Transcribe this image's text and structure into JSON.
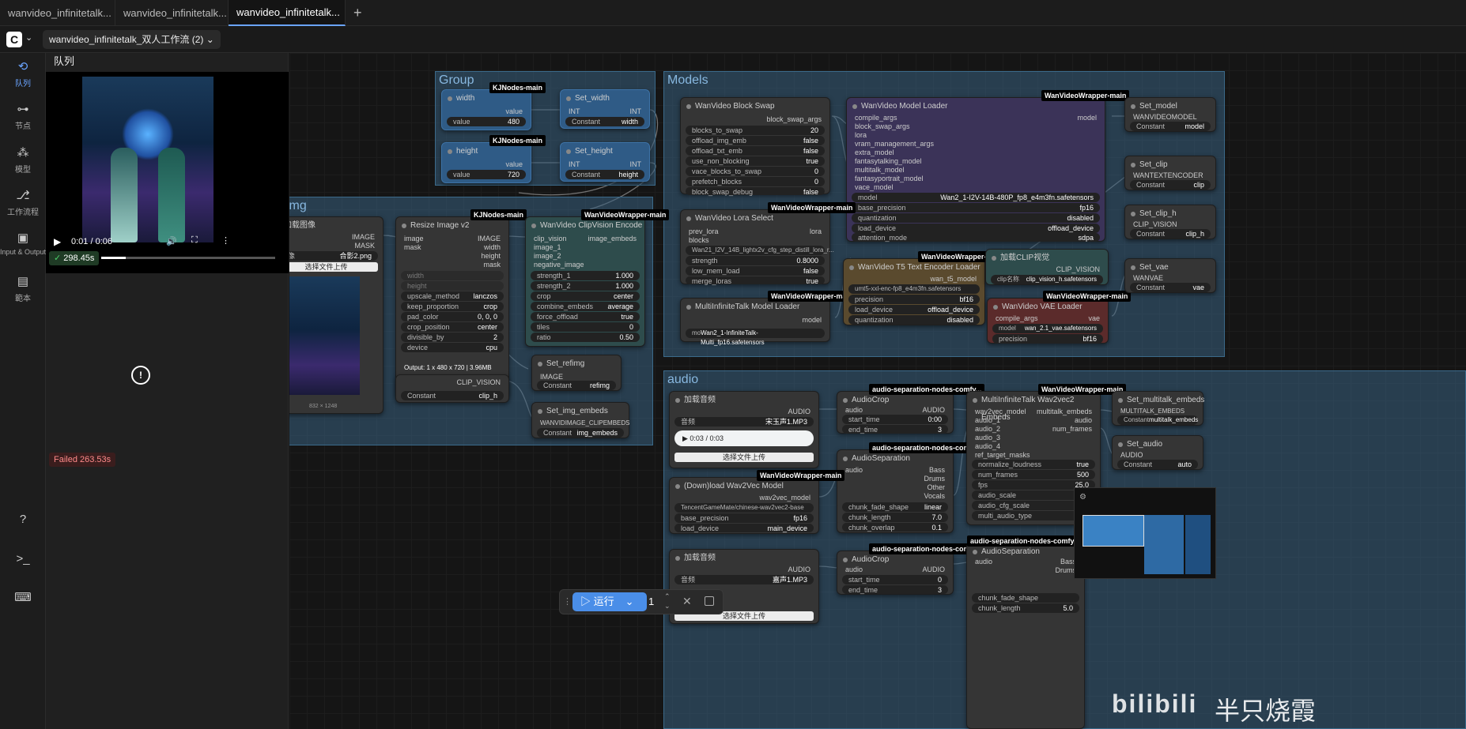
{
  "tabs": [
    {
      "label": "wanvideo_infinitetalk..."
    },
    {
      "label": "wanvideo_infinitetalk..."
    },
    {
      "label": "wanvideo_infinitetalk..."
    }
  ],
  "new_tab": "+",
  "workflow_name": "wanvideo_infinitetalk_双人工作流 (2)",
  "sidebar": [
    {
      "label": "队列",
      "icon": "history-icon"
    },
    {
      "label": "节点",
      "icon": "node-icon"
    },
    {
      "label": "模型",
      "icon": "model-icon"
    },
    {
      "label": "工作流程",
      "icon": "workflow-icon"
    },
    {
      "label": "Input & Output",
      "icon": "image-icon"
    },
    {
      "label": "範本",
      "icon": "template-icon"
    }
  ],
  "queue": {
    "title": "队列",
    "video_time": "0:01 / 0:06",
    "success_badge": "298.45s",
    "failed_badge": "Failed 263.53s"
  },
  "groups": {
    "group": "Group",
    "ref_img": "ref-img",
    "models": "Models",
    "audio": "audio"
  },
  "nodes": {
    "width": {
      "title": "width",
      "badge": "KJNodes-main",
      "out": "value",
      "param": "value",
      "val": "480"
    },
    "height": {
      "title": "height",
      "badge": "KJNodes-main",
      "out": "value",
      "param": "value",
      "val": "720"
    },
    "set_width": {
      "title": "Set_width",
      "in": "INT",
      "out": "INT",
      "param": "Constant",
      "val": "width"
    },
    "set_height": {
      "title": "Set_height",
      "in": "INT",
      "out": "INT",
      "param": "Constant",
      "val": "height"
    },
    "load_img": {
      "title": "加载图像",
      "o1": "IMAGE",
      "o2": "MASK",
      "param": "图像",
      "val": "合影2.png",
      "upload": "选择文件上传",
      "size": "832 × 1248"
    },
    "resize": {
      "title": "Resize Image v2",
      "badge": "KJNodes-main",
      "in1": "image",
      "in2": "mask",
      "o1": "IMAGE",
      "o2": "width",
      "o3": "height",
      "o4": "mask",
      "w": "width",
      "h": "height",
      "rows": [
        [
          "upscale_method",
          "lanczos"
        ],
        [
          "keep_proportion",
          "crop"
        ],
        [
          "pad_color",
          "0, 0, 0"
        ],
        [
          "crop_position",
          "center"
        ],
        [
          "divisible_by",
          "2"
        ],
        [
          "device",
          "cpu"
        ]
      ],
      "output": "Output: 1 x 480 x 720 | 3.96MB",
      "clip_out": "CLIP_VISION",
      "clip_param": "Constant",
      "clip_val": "clip_h"
    },
    "clipvision": {
      "title": "WanVideo ClipVision Encode",
      "badge": "WanVideoWrapper-main",
      "in": [
        "clip_vision",
        "image_1",
        "image_2",
        "negative_image"
      ],
      "out": "image_embeds",
      "rows": [
        [
          "strength_1",
          "1.000"
        ],
        [
          "strength_2",
          "1.000"
        ],
        [
          "crop",
          "center"
        ],
        [
          "combine_embeds",
          "average"
        ],
        [
          "force_offload",
          "true"
        ],
        [
          "tiles",
          "0"
        ],
        [
          "ratio",
          "0.50"
        ]
      ]
    },
    "set_refimg": {
      "title": "Set_refimg",
      "in": "IMAGE",
      "param": "Constant",
      "val": "refimg"
    },
    "set_img_embeds": {
      "title": "Set_img_embeds",
      "in": "WANVIDIMAGE_CLIPEMBEDS",
      "param": "Constant",
      "val": "img_embeds"
    },
    "blockswap": {
      "title": "WanVideo Block Swap",
      "out": "block_swap_args",
      "rows": [
        [
          "blocks_to_swap",
          "20"
        ],
        [
          "offload_img_emb",
          "false"
        ],
        [
          "offload_txt_emb",
          "false"
        ],
        [
          "use_non_blocking",
          "true"
        ],
        [
          "vace_blocks_to_swap",
          "0"
        ],
        [
          "prefetch_blocks",
          "0"
        ],
        [
          "block_swap_debug",
          "false"
        ]
      ]
    },
    "modelloader": {
      "title": "WanVideo Model Loader",
      "badge": "WanVideoWrapper-main",
      "badge2": "WanVideoWrapper-main",
      "out": "model",
      "in": [
        "compile_args",
        "block_swap_args",
        "lora",
        "vram_management_args",
        "extra_model",
        "fantasytalking_model",
        "multitalk_model",
        "fantasyportrait_model",
        "vace_model"
      ],
      "rows": [
        [
          "model",
          "Wan2_1-I2V-14B-480P_fp8_e4m3fn.safetensors"
        ],
        [
          "base_precision",
          "fp16"
        ],
        [
          "quantization",
          "disabled"
        ],
        [
          "load_device",
          "offload_device"
        ],
        [
          "attention_mode",
          "sdpa"
        ]
      ]
    },
    "lora": {
      "title": "WanVideo Lora Select",
      "in1": "prev_lora",
      "in2": "blocks",
      "out": "lora",
      "rows": [
        [
          "",
          "Wan21_I2V_14B_lightx2v_cfg_step_distill_lora_r..."
        ],
        [
          "strength",
          "0.8000"
        ],
        [
          "low_mem_load",
          "false"
        ],
        [
          "merge_loras",
          "true"
        ]
      ]
    },
    "multitalk": {
      "title": "MultiInfiniteTalk Model Loader",
      "badge": "WanVideoWrapper-main",
      "out": "model",
      "row": [
        "mo",
        "Wan2_1-InfiniteTalk-Multi_fp16.safetensors"
      ]
    },
    "t5": {
      "title": "WanVideo T5 Text Encoder Loader",
      "badge": "WanVideoWrapper-main",
      "out": "wan_t5_model",
      "rows": [
        [
          "m",
          "umt5-xxl-enc-fp8_e4m3fn.safetensors"
        ],
        [
          "precision",
          "bf16"
        ],
        [
          "load_device",
          "offload_device"
        ],
        [
          "quantization",
          "disabled"
        ]
      ]
    },
    "clipload": {
      "title": "加载CLIP视觉",
      "out": "CLIP_VISION",
      "row": [
        "clip名称",
        "clip_vision_h.safetensors"
      ]
    },
    "vae": {
      "title": "WanVideo VAE Loader",
      "badge": "WanVideoWrapper-main",
      "in": "compile_args",
      "out": "vae",
      "rows": [
        [
          "model",
          "wan_2.1_vae.safetensors"
        ],
        [
          "precision",
          "bf16"
        ]
      ]
    },
    "set_model": {
      "title": "Set_model",
      "in": "WANVIDEOMODEL",
      "param": "Constant",
      "val": "model"
    },
    "set_clip": {
      "title": "Set_clip",
      "in": "WANTEXTENCODER",
      "param": "Constant",
      "val": "clip"
    },
    "set_clip_h": {
      "title": "Set_clip_h",
      "in": "CLIP_VISION",
      "param": "Constant",
      "val": "clip_h"
    },
    "set_vae": {
      "title": "Set_vae",
      "in": "WANVAE",
      "param": "Constant",
      "val": "vae"
    },
    "loadaudio1": {
      "title": "加载音频",
      "out": "AUDIO",
      "param": "音频",
      "val": "宋玉声1.MP3",
      "time": "0:03 / 0:03",
      "upload": "选择文件上传"
    },
    "audiocrop1": {
      "title": "AudioCrop",
      "badge": "audio-separation-nodes-comfy...",
      "in": "audio",
      "out": "AUDIO",
      "rows": [
        [
          "start_time",
          "0:00"
        ],
        [
          "end_time",
          "3"
        ]
      ]
    },
    "audiosep1": {
      "title": "AudioSeparation",
      "badge": "audio-separation-nodes-comfy...",
      "in": "audio",
      "outs": [
        "Bass",
        "Drums",
        "Other",
        "Vocals"
      ],
      "rows": [
        [
          "chunk_fade_shape",
          "linear"
        ],
        [
          "chunk_length",
          "7.0"
        ],
        [
          "chunk_overlap",
          "0.1"
        ]
      ]
    },
    "wav2vec": {
      "title": "(Down)load Wav2Vec Model",
      "badge": "WanVideoWrapper-main",
      "out": "wav2vec_model",
      "rows": [
        [
          "",
          "TencentGameMate/chinese-wav2vec2-base"
        ],
        [
          "base_precision",
          "fp16"
        ],
        [
          "load_device",
          "main_device"
        ]
      ]
    },
    "embeds": {
      "title": "MultiInfiniteTalk Wav2vec2 Embeds",
      "badge": "WanVideoWrapper-main",
      "in": [
        "wav2vec_model",
        "audio_1",
        "audio_2",
        "audio_3",
        "audio_4",
        "ref_target_masks"
      ],
      "out": [
        "multitalk_embeds",
        "audio",
        "num_frames"
      ],
      "rows": [
        [
          "normalize_loudness",
          "true"
        ],
        [
          "num_frames",
          "500"
        ],
        [
          "fps",
          "25.0"
        ],
        [
          "audio_scale",
          ""
        ],
        [
          "audio_cfg_scale",
          ""
        ],
        [
          "multi_audio_type",
          ""
        ]
      ]
    },
    "set_multitalk": {
      "title": "Set_multitalk_embeds",
      "in": "MULTITALK_EMBEDS",
      "param": "Constant",
      "val": "multitalk_embeds"
    },
    "set_audio": {
      "title": "Set_audio",
      "in": "AUDIO",
      "param": "Constant",
      "val": "auto"
    },
    "loadaudio2": {
      "title": "加载音频",
      "out": "AUDIO",
      "param": "音频",
      "val": "嘉声1.MP3",
      "upload": "选择文件上传"
    },
    "audiocrop2": {
      "title": "AudioCrop",
      "badge": "audio-separation-nodes-comfy...",
      "in": "audio",
      "out": "AUDIO",
      "rows": [
        [
          "start_time",
          "0"
        ],
        [
          "end_time",
          "3"
        ]
      ]
    },
    "audiosep2": {
      "title": "AudioSeparation",
      "badge": "audio-separation-nodes-comfy...",
      "in": "audio",
      "outs": [
        "Bass",
        "Drums"
      ],
      "rows": [
        [
          "chunk_fade_shape",
          ""
        ],
        [
          "chunk_length",
          "5.0"
        ],
        [
          "",
          ""
        ]
      ]
    }
  },
  "runbar": {
    "run": "运行",
    "count": "1"
  },
  "watermark": "半只烧霞"
}
